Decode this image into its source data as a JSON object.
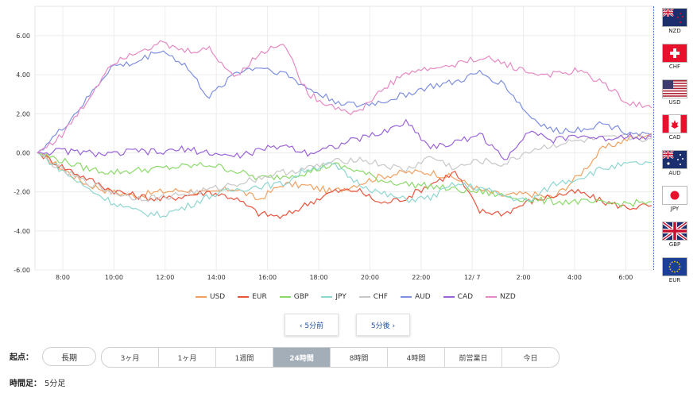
{
  "chart_data": {
    "type": "line",
    "y_ticks": [
      "6.00",
      "4.00",
      "2.00",
      "0.00",
      "-2.00",
      "-4.00",
      "-6.00"
    ],
    "ylim": [
      -6,
      7.5
    ],
    "x_ticks": [
      "8:00",
      "10:00",
      "12:00",
      "14:00",
      "16:00",
      "18:00",
      "20:00",
      "22:00",
      "12/ 7",
      "2:00",
      "4:00",
      "6:00"
    ],
    "grid": true,
    "legend_position": "bottom",
    "series": [
      {
        "name": "USD",
        "color": "#f0a060",
        "values": [
          0,
          -0.8,
          -1.6,
          -2.0,
          -2.2,
          -2.0,
          -1.9,
          -2.1,
          -1.8,
          -2.4,
          -1.6,
          -1.7,
          -2.0,
          -1.6,
          -1.2,
          -1.0,
          -1.0,
          -1.3,
          -1.9,
          -2.2,
          -2.1,
          -2.3,
          -1.2,
          0.2,
          0.7,
          1.0
        ]
      },
      {
        "name": "EUR",
        "color": "#e8553f",
        "values": [
          0,
          -0.7,
          -1.3,
          -1.9,
          -2.2,
          -2.4,
          -2.2,
          -2.0,
          -2.3,
          -3.1,
          -3.3,
          -2.6,
          -2.0,
          -1.9,
          -2.6,
          -2.3,
          -1.6,
          -1.0,
          -3.0,
          -3.1,
          -2.5,
          -2.2,
          -2.0,
          -2.5,
          -2.8,
          -2.7
        ]
      },
      {
        "name": "GBP",
        "color": "#8bd96a",
        "values": [
          0,
          -0.4,
          -0.8,
          -1.0,
          -0.9,
          -0.8,
          -0.7,
          -0.6,
          -0.9,
          -1.3,
          -1.2,
          -1.0,
          -0.6,
          -0.9,
          -1.4,
          -1.6,
          -1.7,
          -1.9,
          -2.0,
          -2.2,
          -2.4,
          -2.5,
          -2.5,
          -2.6,
          -2.6,
          -2.5
        ]
      },
      {
        "name": "JPY",
        "color": "#8fd6d0",
        "values": [
          0,
          -0.9,
          -1.8,
          -2.5,
          -3.0,
          -3.2,
          -2.8,
          -2.2,
          -1.9,
          -1.7,
          -1.6,
          -0.8,
          -0.6,
          -1.5,
          -2.1,
          -2.4,
          -2.3,
          -1.6,
          -1.8,
          -2.2,
          -2.5,
          -1.6,
          -1.3,
          -0.8,
          -0.6,
          -0.5
        ]
      },
      {
        "name": "CHF",
        "color": "#c8c8c8",
        "values": [
          0,
          -0.9,
          -1.5,
          -2.0,
          -2.3,
          -2.3,
          -2.1,
          -1.9,
          -1.6,
          -1.3,
          -1.0,
          -0.8,
          -0.5,
          -0.3,
          -0.6,
          -0.9,
          -0.2,
          -0.8,
          -0.4,
          -0.6,
          0.1,
          0.4,
          0.6,
          0.7,
          0.8,
          0.7
        ]
      },
      {
        "name": "AUD",
        "color": "#7e8fe0",
        "values": [
          0,
          1.2,
          2.7,
          4.4,
          4.6,
          5.3,
          4.5,
          2.8,
          4.1,
          4.4,
          4.1,
          3.3,
          2.7,
          2.4,
          2.6,
          3.0,
          3.4,
          3.6,
          4.1,
          3.5,
          1.9,
          1.1,
          1.2,
          1.5,
          1.1,
          0.9
        ]
      },
      {
        "name": "CAD",
        "color": "#9a63d8",
        "values": [
          0,
          0.1,
          0.0,
          -0.1,
          0.1,
          0.0,
          0.2,
          0.0,
          -0.2,
          0.1,
          0.4,
          0.0,
          0.3,
          0.7,
          1.0,
          1.6,
          0.3,
          0.5,
          1.0,
          -0.4,
          1.2,
          0.6,
          0.9,
          0.7,
          0.9,
          0.8
        ]
      },
      {
        "name": "NZD",
        "color": "#e58ac4",
        "values": [
          0,
          0.9,
          2.6,
          4.6,
          5.2,
          5.6,
          5.2,
          5.3,
          3.9,
          5.0,
          5.7,
          3.0,
          2.4,
          2.0,
          3.2,
          4.1,
          4.3,
          4.5,
          4.9,
          4.6,
          4.1,
          4.0,
          4.2,
          3.6,
          2.6,
          2.3
        ]
      }
    ]
  },
  "nav": {
    "prev_label": "‹ 5分前",
    "next_label": "5分後 ›"
  },
  "origin": {
    "label": "起点：",
    "long_term": "長期",
    "options": [
      "3ヶ月",
      "1ヶ月",
      "1週間",
      "24時間",
      "8時間",
      "4時間",
      "前営業日",
      "今日"
    ],
    "active_index": 3
  },
  "timeframe": {
    "label": "時間足：",
    "value": "5分足"
  },
  "flags": [
    {
      "code": "NZD",
      "icon": "nz-flag-icon"
    },
    {
      "code": "CHF",
      "icon": "ch-flag-icon"
    },
    {
      "code": "USD",
      "icon": "us-flag-icon"
    },
    {
      "code": "CAD",
      "icon": "ca-flag-icon"
    },
    {
      "code": "AUD",
      "icon": "au-flag-icon"
    },
    {
      "code": "JPY",
      "icon": "jp-flag-icon"
    },
    {
      "code": "GBP",
      "icon": "gb-flag-icon"
    },
    {
      "code": "EUR",
      "icon": "eu-flag-icon"
    }
  ]
}
